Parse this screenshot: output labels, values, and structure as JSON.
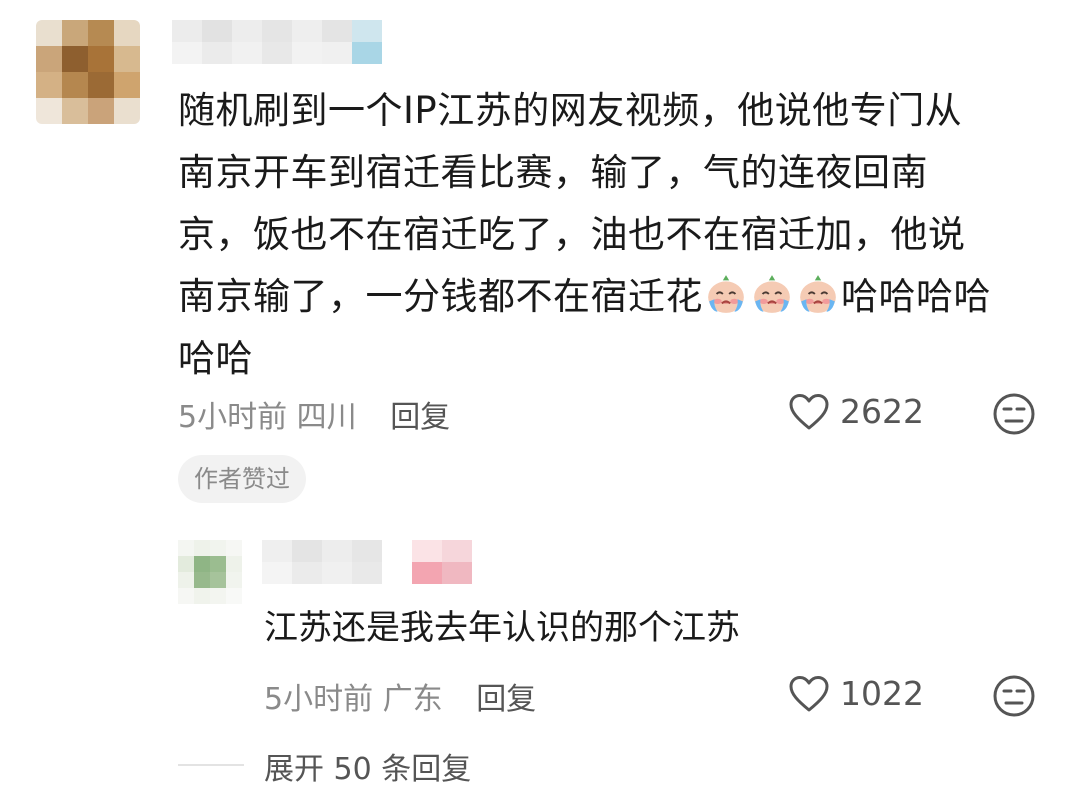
{
  "comment": {
    "lines": [
      "随机刷到一个IP江苏的网友视频，他说他专门从",
      "南京开车到宿迁看比赛，输了，气的连夜回南",
      "京，饭也不在宿迁吃了，油也不在宿迁加，他说",
      "南京输了，一分钱都不在宿迁花",
      "哈哈哈哈",
      "哈哈"
    ],
    "emoji_icon": "crying-face-emoji",
    "emoji_count": 3,
    "time": "5小时前",
    "location": "四川",
    "reply_label": "回复",
    "likes": "2622",
    "author_tag": "作者赞过"
  },
  "reply": {
    "text": "江苏还是我去年认识的那个江苏",
    "time": "5小时前",
    "location": "广东",
    "reply_label": "回复",
    "likes": "1022"
  },
  "expand_label": "展开 50 条回复",
  "icons": {
    "like": "heart-outline-icon",
    "dislike": "neutral-face-icon"
  },
  "colors": {
    "text": "#1a1a1a",
    "meta": "#8a8a8a",
    "tag_bg": "#f2f2f2"
  }
}
